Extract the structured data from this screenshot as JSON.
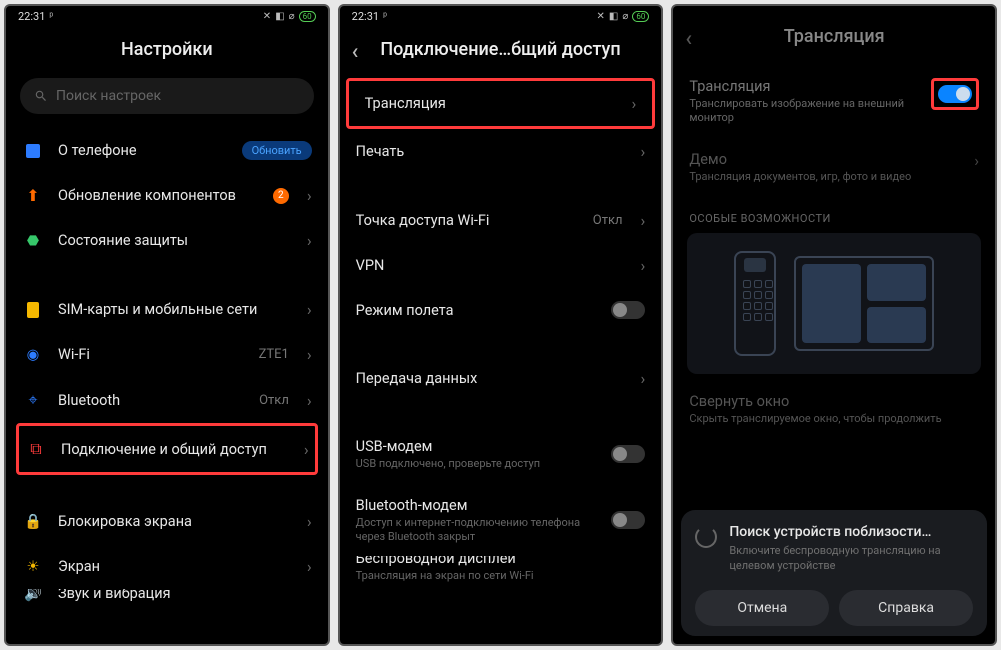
{
  "status": {
    "time": "22:31",
    "battery_text": "60"
  },
  "screen1": {
    "title": "Настройки",
    "search_placeholder": "Поиск настроек",
    "rows": {
      "about": {
        "label": "О телефоне",
        "action": "Обновить"
      },
      "updates": {
        "label": "Обновление компонентов",
        "badge": "2"
      },
      "security": {
        "label": "Состояние защиты"
      },
      "sim": {
        "label": "SIM-карты и мобильные сети"
      },
      "wifi": {
        "label": "Wi-Fi",
        "value": "ZTE1"
      },
      "bt": {
        "label": "Bluetooth",
        "value": "Откл"
      },
      "sharing": {
        "label": "Подключение и общий доступ"
      },
      "lock": {
        "label": "Блокировка экрана"
      },
      "display": {
        "label": "Экран"
      },
      "sound": {
        "label": "Звук и вибрация"
      }
    }
  },
  "screen2": {
    "title": "Подключение…бщий доступ",
    "rows": {
      "cast": {
        "label": "Трансляция"
      },
      "print": {
        "label": "Печать"
      },
      "hotspot": {
        "label": "Точка доступа Wi-Fi",
        "value": "Откл"
      },
      "vpn": {
        "label": "VPN"
      },
      "airplane": {
        "label": "Режим полета"
      },
      "data": {
        "label": "Передача данных"
      },
      "usb": {
        "label": "USB-модем",
        "sub": "USB подключено, проверьте доступ"
      },
      "btm": {
        "label": "Bluetooth-модем",
        "sub": "Доступ к интернет-подключению телефона через Bluetooth закрыт"
      },
      "wd": {
        "label": "Беспроводной дисплей",
        "sub": "Трансляция на экран по сети Wi-Fi"
      }
    }
  },
  "screen3": {
    "title": "Трансляция",
    "rows": {
      "cast": {
        "label": "Трансляция",
        "sub": "Транслировать изображение на внешний монитор"
      },
      "demo": {
        "label": "Демо",
        "sub": "Трансляция документов, игр, фото и видео"
      },
      "special_header": "ОСОБЫЕ ВОЗМОЖНОСТИ",
      "minimize": {
        "label": "Свернуть окно",
        "sub": "Скрыть транслируемое окно, чтобы продолжить"
      }
    },
    "sheet": {
      "title": "Поиск устройств поблизости…",
      "sub": "Включите беспроводную трансляцию на целевом устройстве",
      "cancel": "Отмена",
      "help": "Справка"
    }
  }
}
